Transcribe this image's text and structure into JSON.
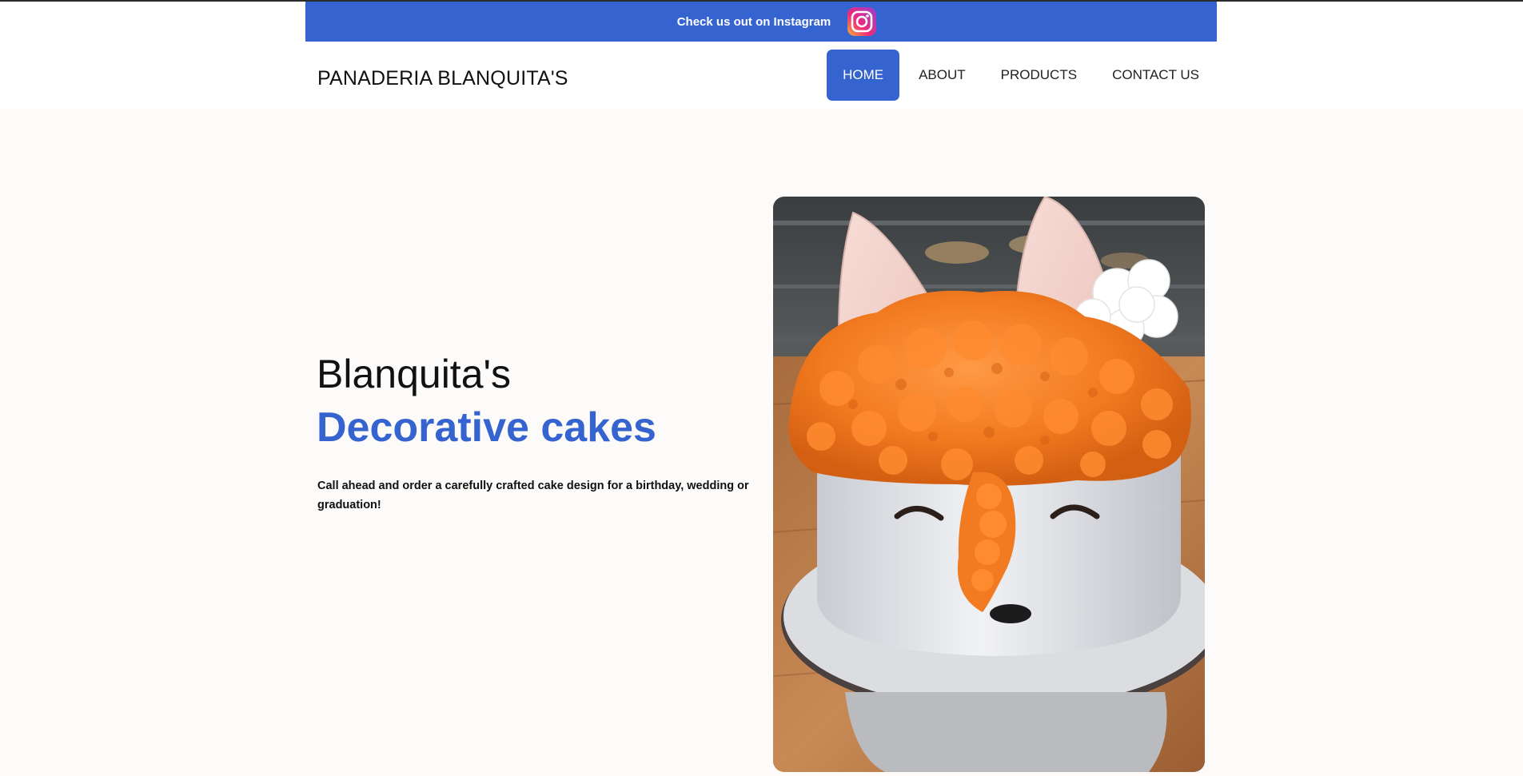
{
  "promo": {
    "text": "Check us out on Instagram",
    "icon": "instagram-icon"
  },
  "brand": {
    "name": "PANADERIA BLANQUITA'S"
  },
  "nav": {
    "items": [
      {
        "label": "HOME",
        "active": true
      },
      {
        "label": "ABOUT",
        "active": false
      },
      {
        "label": "PRODUCTS",
        "active": false
      },
      {
        "label": "CONTACT US",
        "active": false
      }
    ]
  },
  "hero": {
    "title_line1": "Blanquita's",
    "title_line2": "Decorative cakes",
    "body": "Call ahead and order a carefully crafted cake design for a birthday, wedding or graduation!",
    "image_subject": "fox-cake-photo"
  },
  "colors": {
    "accent": "#3563cf",
    "background": "#fcfbfa",
    "text": "#111111"
  }
}
